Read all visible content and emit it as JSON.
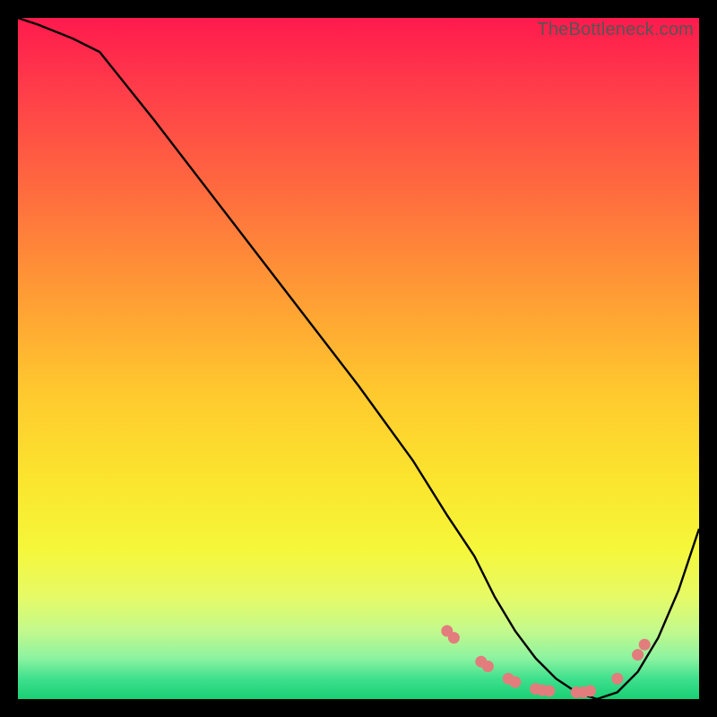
{
  "watermark": "TheBottleneck.com",
  "chart_data": {
    "type": "line",
    "title": "",
    "xlabel": "",
    "ylabel": "",
    "xlim": [
      0,
      100
    ],
    "ylim": [
      0,
      100
    ],
    "series": [
      {
        "name": "bottleneck-curve",
        "x": [
          0,
          3,
          8,
          12,
          20,
          30,
          40,
          50,
          58,
          63,
          67,
          70,
          73,
          76,
          79,
          82,
          85,
          88,
          91,
          94,
          97,
          100
        ],
        "y": [
          100,
          99,
          97,
          95,
          85,
          72,
          59,
          46,
          35,
          27,
          21,
          15,
          10,
          6,
          3,
          1,
          0,
          1,
          4,
          9,
          16,
          25
        ]
      }
    ],
    "markers": [
      {
        "x": 63,
        "y": 10.0
      },
      {
        "x": 64,
        "y": 9.0
      },
      {
        "x": 68,
        "y": 5.5
      },
      {
        "x": 69,
        "y": 4.8
      },
      {
        "x": 72,
        "y": 3.0
      },
      {
        "x": 73,
        "y": 2.5
      },
      {
        "x": 76,
        "y": 1.5
      },
      {
        "x": 77,
        "y": 1.3
      },
      {
        "x": 78,
        "y": 1.2
      },
      {
        "x": 82,
        "y": 1.0
      },
      {
        "x": 83,
        "y": 1.0
      },
      {
        "x": 84,
        "y": 1.2
      },
      {
        "x": 88,
        "y": 3.0
      },
      {
        "x": 91,
        "y": 6.5
      },
      {
        "x": 92,
        "y": 8.0
      }
    ],
    "marker_color": "#e37c7c",
    "line_color": "#000000"
  }
}
